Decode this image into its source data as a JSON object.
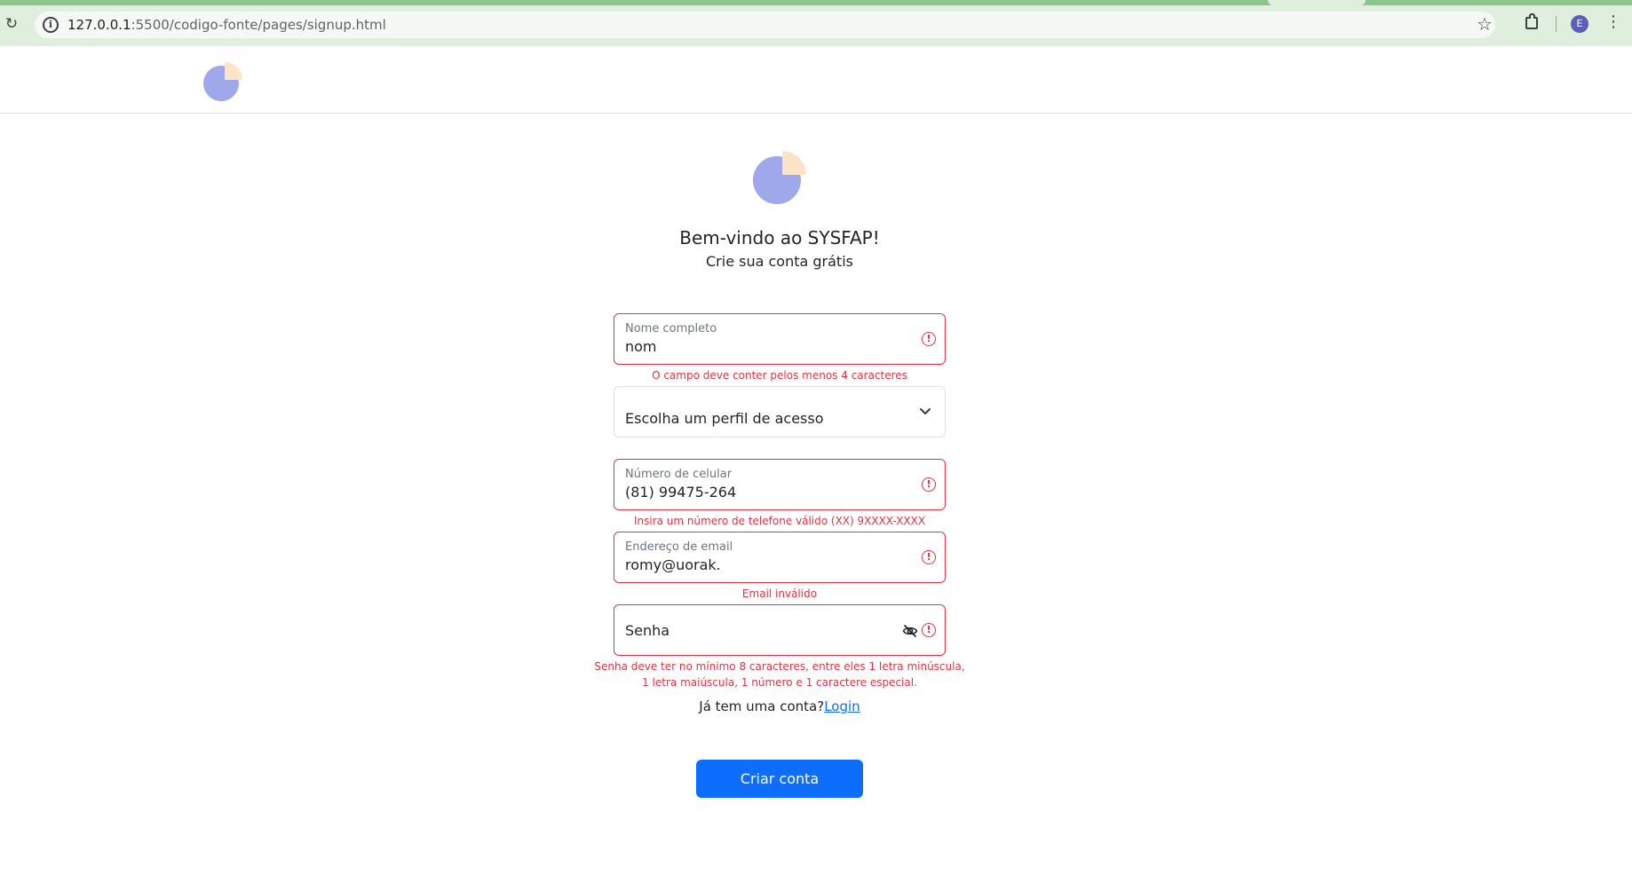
{
  "browser": {
    "url_host": "127.0.0.1",
    "url_rest": ":5500/codigo-fonte/pages/signup.html",
    "profile_initial": "E",
    "icons": [
      "reload-icon",
      "site-info-icon",
      "star-icon",
      "extensions-icon",
      "kebab-menu-icon"
    ]
  },
  "header": {
    "logo": "pie-chart-logo"
  },
  "hero": {
    "title": "Bem-vindo ao SYSFAP!",
    "subtitle": "Crie sua conta grátis"
  },
  "form": {
    "name": {
      "label": "Nome completo",
      "value": "nom",
      "error": "O campo deve conter pelos menos 4 caracteres"
    },
    "profile": {
      "selected": "Escolha um perfil de acesso"
    },
    "phone": {
      "label": "Número de celular",
      "value": "(81) 99475-264",
      "error": "Insira um número de telefone válido (XX) 9XXXX-XXXX"
    },
    "email": {
      "label": "Endereço de email",
      "value": "romy@uorak.",
      "error": "Email inválido"
    },
    "password": {
      "placeholder": "Senha",
      "error_line1": "Senha deve ter no mínimo 8 caracteres, entre eles 1 letra minúscula,",
      "error_line2": "1 letra maiúscula, 1 número e 1 caractere especial."
    },
    "login_prompt": "Já tem uma conta?",
    "login_link": "Login",
    "submit": "Criar conta"
  },
  "colors": {
    "logo_main": "#9ea8ea",
    "logo_slice": "#fde3c8",
    "error": "#dc3545",
    "primary": "#0d6efd"
  }
}
